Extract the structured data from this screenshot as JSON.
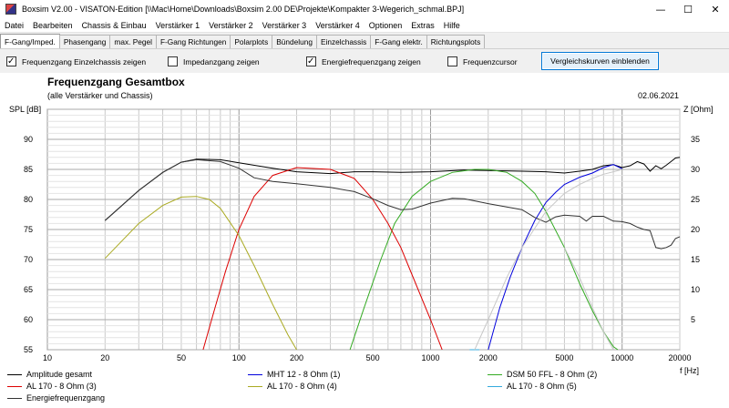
{
  "window": {
    "title": "Boxsim V2.00 - VISATON-Edition [\\\\Mac\\Home\\Downloads\\Boxsim 2.00 DE\\Projekte\\Kompakter 3-Wegerich_schmal.BPJ]",
    "controls": [
      "—",
      "☐",
      "✕"
    ]
  },
  "menu": [
    "Datei",
    "Bearbeiten",
    "Chassis & Einbau",
    "Verstärker 1",
    "Verstärker 2",
    "Verstärker 3",
    "Verstärker 4",
    "Optionen",
    "Extras",
    "Hilfe"
  ],
  "tabs": [
    {
      "label": "F-Gang/Imped.",
      "active": true
    },
    {
      "label": "Phasengang",
      "active": false
    },
    {
      "label": "max. Pegel",
      "active": false
    },
    {
      "label": "F-Gang Richtungen",
      "active": false
    },
    {
      "label": "Polarplots",
      "active": false
    },
    {
      "label": "Bündelung",
      "active": false
    },
    {
      "label": "Einzelchassis",
      "active": false
    },
    {
      "label": "F-Gang elektr.",
      "active": false
    },
    {
      "label": "Richtungsplots",
      "active": false
    }
  ],
  "options": [
    {
      "label": "Frequenzgang Einzelchassis zeigen",
      "checked": true
    },
    {
      "label": "Impedanzgang zeigen",
      "checked": false
    },
    {
      "label": "Energiefrequenzgang zeigen",
      "checked": true
    },
    {
      "label": "Frequenzcursor",
      "checked": false
    }
  ],
  "compare_button": "Vergleichskurven einblenden",
  "plot": {
    "title": "Frequenzgang Gesamtbox",
    "subtitle": "(alle Verstärker und Chassis)",
    "date": "02.06.2021",
    "left_axis_title": "SPL [dB]",
    "right_axis_title": "Z [Ohm]",
    "x_axis_title": "f [Hz]"
  },
  "legend": [
    {
      "label": "Amplitude gesamt",
      "color": "#000000"
    },
    {
      "label": "MHT 12 - 8 Ohm (1)",
      "color": "#0000dd"
    },
    {
      "label": "DSM 50 FFL - 8 Ohm (2)",
      "color": "#33aa22"
    },
    {
      "label": "AL 170 - 8 Ohm (3)",
      "color": "#dd0000"
    },
    {
      "label": "AL 170 - 8 Ohm (4)",
      "color": "#aaaa22"
    },
    {
      "label": "AL 170 - 8 Ohm (5)",
      "color": "#33aadd"
    },
    {
      "label": "Energiefrequenzgang",
      "color": "#333333"
    }
  ],
  "chart_data": {
    "type": "line",
    "x_scale": "log",
    "xlim": [
      10,
      20000
    ],
    "ylim": [
      55,
      95
    ],
    "y2lim": [
      0,
      40
    ],
    "x_ticks": [
      10,
      20,
      50,
      100,
      200,
      500,
      1000,
      2000,
      5000,
      10000,
      20000
    ],
    "x_tick_labels": [
      "10",
      "20",
      "50",
      "100",
      "200",
      "500",
      "1000",
      "2000",
      "5000",
      "10000",
      "20000"
    ],
    "y_ticks": [
      55,
      60,
      65,
      70,
      75,
      80,
      85,
      90
    ],
    "y_tick_labels": [
      "55",
      "60",
      "65",
      "70",
      "75",
      "80",
      "85",
      "90"
    ],
    "y2_ticks": [
      5,
      10,
      15,
      20,
      25,
      30,
      35
    ],
    "y2_tick_labels": [
      "5",
      "10",
      "15",
      "20",
      "25",
      "30",
      "35"
    ],
    "grid": true,
    "series": [
      {
        "name": "Amplitude gesamt",
        "color": "#000000",
        "points": [
          [
            20,
            76.5
          ],
          [
            30,
            81.5
          ],
          [
            40,
            84.5
          ],
          [
            50,
            86.2
          ],
          [
            60,
            86.7
          ],
          [
            80,
            86.6
          ],
          [
            100,
            86.1
          ],
          [
            150,
            85.2
          ],
          [
            200,
            84.6
          ],
          [
            300,
            84.3
          ],
          [
            400,
            84.6
          ],
          [
            500,
            84.6
          ],
          [
            700,
            84.5
          ],
          [
            1000,
            84.6
          ],
          [
            1500,
            84.9
          ],
          [
            2000,
            84.8
          ],
          [
            3000,
            84.7
          ],
          [
            4000,
            84.6
          ],
          [
            5000,
            84.4
          ],
          [
            6000,
            84.7
          ],
          [
            7000,
            85.0
          ],
          [
            8000,
            85.6
          ],
          [
            9000,
            85.8
          ],
          [
            10000,
            85.3
          ],
          [
            11000,
            85.6
          ],
          [
            12000,
            86.3
          ],
          [
            13000,
            85.9
          ],
          [
            14000,
            84.7
          ],
          [
            15000,
            85.6
          ],
          [
            16000,
            85.1
          ],
          [
            17000,
            85.7
          ],
          [
            18000,
            86.3
          ],
          [
            19000,
            86.9
          ],
          [
            20000,
            87.0
          ]
        ]
      },
      {
        "name": "MHT 12 - 8 Ohm (1)",
        "color": "#0000dd",
        "points": [
          [
            2000,
            55
          ],
          [
            2300,
            62
          ],
          [
            2600,
            67
          ],
          [
            3000,
            72
          ],
          [
            3500,
            76.5
          ],
          [
            4000,
            79.5
          ],
          [
            4500,
            81.2
          ],
          [
            5000,
            82.5
          ],
          [
            6000,
            83.7
          ],
          [
            7000,
            84.4
          ],
          [
            8000,
            85.3
          ],
          [
            9000,
            85.8
          ],
          [
            10000,
            85.1
          ]
        ]
      },
      {
        "name": "DSM 50 FFL - 8 Ohm (2)",
        "color": "#33aa22",
        "points": [
          [
            380,
            55
          ],
          [
            450,
            62
          ],
          [
            550,
            70
          ],
          [
            650,
            76
          ],
          [
            800,
            80.5
          ],
          [
            1000,
            83
          ],
          [
            1300,
            84.5
          ],
          [
            1700,
            85.0
          ],
          [
            2000,
            85.0
          ],
          [
            2500,
            84.5
          ],
          [
            3000,
            83
          ],
          [
            3500,
            81
          ],
          [
            4000,
            78
          ],
          [
            5000,
            72
          ],
          [
            6000,
            66
          ],
          [
            7000,
            61.5
          ],
          [
            8000,
            58
          ],
          [
            9000,
            55.5
          ],
          [
            9500,
            55
          ]
        ]
      },
      {
        "name": "AL 170 - 8 Ohm (3)",
        "color": "#dd0000",
        "points": [
          [
            65,
            55
          ],
          [
            75,
            62
          ],
          [
            85,
            68
          ],
          [
            100,
            75
          ],
          [
            120,
            80.5
          ],
          [
            150,
            84
          ],
          [
            200,
            85.3
          ],
          [
            300,
            85.0
          ],
          [
            400,
            83.5
          ],
          [
            500,
            80
          ],
          [
            600,
            76
          ],
          [
            700,
            72
          ],
          [
            800,
            67.5
          ],
          [
            1000,
            60
          ],
          [
            1150,
            55
          ]
        ]
      },
      {
        "name": "AL 170 - 8 Ohm (4)",
        "color": "#aaaa22",
        "points": [
          [
            20,
            70.2
          ],
          [
            30,
            76
          ],
          [
            40,
            79
          ],
          [
            50,
            80.4
          ],
          [
            60,
            80.5
          ],
          [
            70,
            80
          ],
          [
            80,
            78.5
          ],
          [
            100,
            74
          ],
          [
            120,
            69
          ],
          [
            150,
            62.5
          ],
          [
            180,
            57.5
          ],
          [
            200,
            55
          ]
        ]
      },
      {
        "name": "AL 170 - 8 Ohm (5)",
        "color": "#33aadd",
        "points": [
          [
            1600,
            55
          ],
          [
            1800,
            55
          ]
        ]
      },
      {
        "name": "Energiefrequenzgang",
        "color": "#333333",
        "points": [
          [
            20,
            76.5
          ],
          [
            30,
            81.5
          ],
          [
            40,
            84.5
          ],
          [
            50,
            86.2
          ],
          [
            60,
            86.6
          ],
          [
            80,
            86.3
          ],
          [
            100,
            85.2
          ],
          [
            120,
            83.6
          ],
          [
            150,
            83.0
          ],
          [
            200,
            82.6
          ],
          [
            300,
            82.0
          ],
          [
            400,
            81.3
          ],
          [
            500,
            80.1
          ],
          [
            600,
            79.0
          ],
          [
            700,
            78.3
          ],
          [
            800,
            78.4
          ],
          [
            1000,
            79.4
          ],
          [
            1300,
            80.2
          ],
          [
            1500,
            80.1
          ],
          [
            2000,
            79.3
          ],
          [
            3000,
            78.3
          ],
          [
            3500,
            77.0
          ],
          [
            4000,
            76.2
          ],
          [
            4500,
            77.1
          ],
          [
            5000,
            77.4
          ],
          [
            6000,
            77.2
          ],
          [
            6500,
            76.4
          ],
          [
            7000,
            77.2
          ],
          [
            8000,
            77.2
          ],
          [
            9000,
            76.4
          ],
          [
            10000,
            76.3
          ],
          [
            11000,
            76.0
          ],
          [
            12000,
            75.4
          ],
          [
            13000,
            75.0
          ],
          [
            14000,
            74.8
          ],
          [
            15000,
            72.0
          ],
          [
            16000,
            71.8
          ],
          [
            17000,
            72.0
          ],
          [
            18000,
            72.4
          ],
          [
            19000,
            73.5
          ],
          [
            20000,
            73.8
          ]
        ]
      },
      {
        "name": "",
        "color": "#c8c8c8",
        "points": [
          [
            1700,
            55
          ],
          [
            2000,
            60
          ],
          [
            2500,
            67
          ],
          [
            3000,
            72
          ],
          [
            4000,
            78
          ],
          [
            5000,
            81
          ],
          [
            6000,
            82.5
          ],
          [
            7000,
            83.5
          ],
          [
            8000,
            84.2
          ],
          [
            9000,
            84.6
          ],
          [
            10000,
            85
          ]
        ]
      },
      {
        "name": "",
        "color": "#c8c8c8",
        "points": [
          [
            5000,
            72
          ],
          [
            6000,
            67
          ],
          [
            7000,
            62
          ],
          [
            8000,
            58
          ],
          [
            9000,
            55
          ]
        ]
      }
    ]
  }
}
